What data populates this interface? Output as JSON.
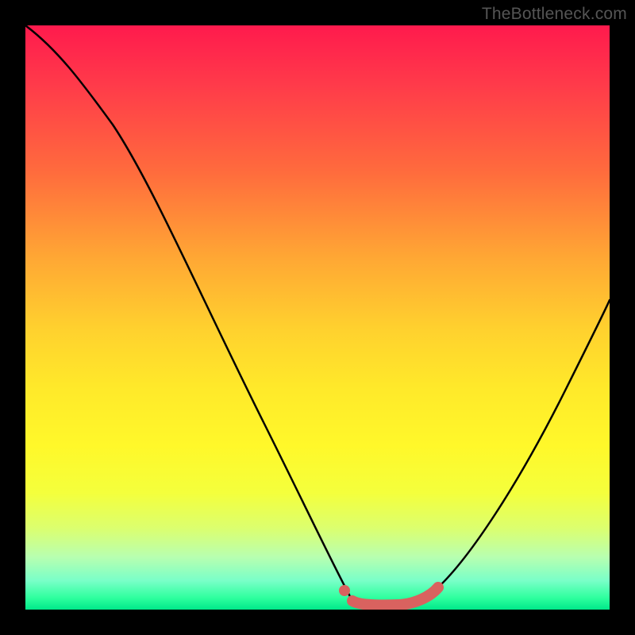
{
  "watermark": "TheBottleneck.com",
  "chart_data": {
    "type": "line",
    "title": "",
    "xlabel": "",
    "ylabel": "",
    "xlim": [
      0,
      1
    ],
    "ylim": [
      0,
      1
    ],
    "series": [
      {
        "name": "curve",
        "points": [
          {
            "x": 0.0,
            "y": 1.0
          },
          {
            "x": 0.08,
            "y": 0.93
          },
          {
            "x": 0.15,
            "y": 0.83
          },
          {
            "x": 0.25,
            "y": 0.64
          },
          {
            "x": 0.35,
            "y": 0.43
          },
          {
            "x": 0.45,
            "y": 0.2
          },
          {
            "x": 0.52,
            "y": 0.06
          },
          {
            "x": 0.56,
            "y": 0.014
          },
          {
            "x": 0.6,
            "y": 0.008
          },
          {
            "x": 0.66,
            "y": 0.01
          },
          {
            "x": 0.7,
            "y": 0.03
          },
          {
            "x": 0.76,
            "y": 0.085
          },
          {
            "x": 0.83,
            "y": 0.19
          },
          {
            "x": 0.9,
            "y": 0.32
          },
          {
            "x": 0.96,
            "y": 0.44
          },
          {
            "x": 1.0,
            "y": 0.53
          }
        ]
      },
      {
        "name": "highlight",
        "points": [
          {
            "x": 0.545,
            "y": 0.03
          },
          {
            "x": 0.56,
            "y": 0.014
          },
          {
            "x": 0.6,
            "y": 0.008
          },
          {
            "x": 0.66,
            "y": 0.01
          },
          {
            "x": 0.7,
            "y": 0.03
          }
        ]
      }
    ],
    "colors": {
      "curve": "#000000",
      "highlight": "#d9625f",
      "gradient_top": "#ff1a4d",
      "gradient_bottom": "#00e88a"
    }
  }
}
